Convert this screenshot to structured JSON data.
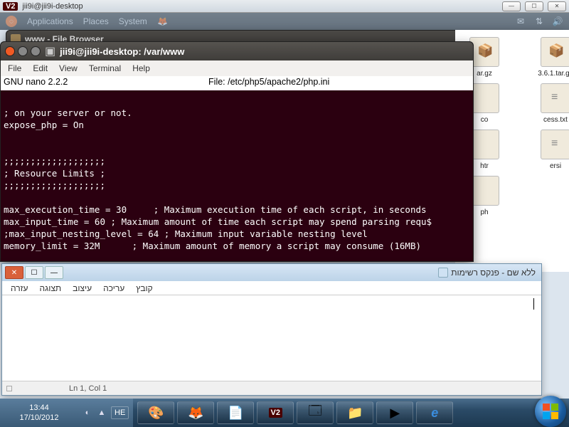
{
  "vnc": {
    "title": "jii9i@jii9i-desktop"
  },
  "ubuntu_panel": {
    "menu": [
      "Applications",
      "Places",
      "System"
    ]
  },
  "filebrowser": {
    "title": "www - File Browser",
    "path": "www"
  },
  "files": [
    {
      "label": "ar.gz"
    },
    {
      "label": "3.6.1.tar.gz"
    },
    {
      "label": "co"
    },
    {
      "label": "cess.txt"
    },
    {
      "label": "htr"
    },
    {
      "label": "ersi"
    },
    {
      "label": "ph"
    }
  ],
  "terminal": {
    "title": "jii9i@jii9i-desktop: /var/www",
    "menu": [
      "File",
      "Edit",
      "View",
      "Terminal",
      "Help"
    ],
    "status_left": "  GNU nano 2.2.2",
    "status_center": "File: /etc/php5/apache2/php.ini",
    "body": "\n; on your server or not.\nexpose_php = On\n\n\n;;;;;;;;;;;;;;;;;;;\n; Resource Limits ;\n;;;;;;;;;;;;;;;;;;;\n\nmax_execution_time = 30     ; Maximum execution time of each script, in seconds\nmax_input_time = 60 ; Maximum amount of time each script may spend parsing requ$\n;max_input_nesting_level = 64 ; Maximum input variable nesting level\nmemory_limit = 32M      ; Maximum amount of memory a script may consume (16MB)"
  },
  "notepad": {
    "title": "ללא שם - פנקס רשימות",
    "menu": [
      "קובץ",
      "עריכה",
      "עיצוב",
      "תצוגה",
      "עזרה"
    ],
    "status": "Ln 1, Col 1"
  },
  "taskbar": {
    "time": "13:44",
    "date": "17/10/2012",
    "lang": "HE",
    "apps": [
      "paint",
      "firefox",
      "word",
      "vnc",
      "calculator",
      "explorer",
      "media",
      "ie"
    ]
  }
}
